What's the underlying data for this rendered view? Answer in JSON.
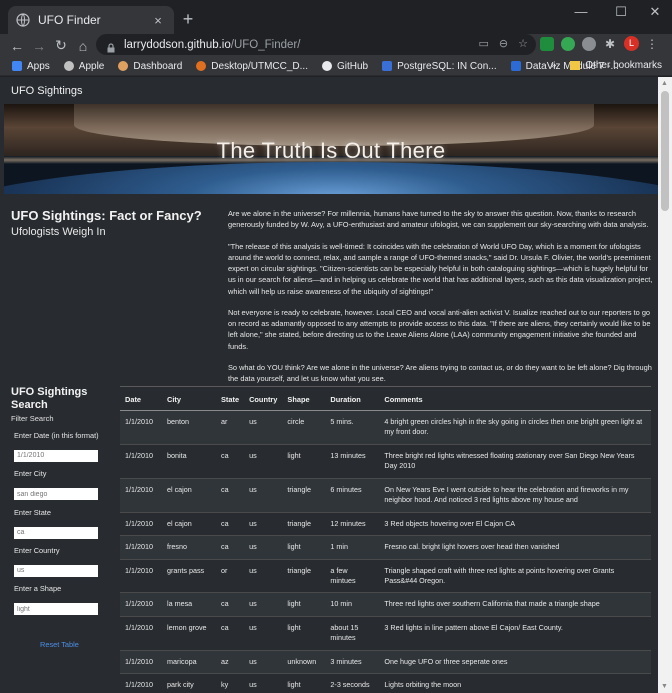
{
  "browser": {
    "tab_title": "UFO Finder",
    "tab_close": "×",
    "new_tab": "+",
    "url_host": "larrydodson.github.io",
    "url_path": "/UFO_Finder/",
    "profile_initial": "L",
    "bookmarks": [
      "Apps",
      "Apple",
      "Dashboard",
      "Desktop/UTMCC_D...",
      "GitHub",
      "PostgreSQL: IN Con...",
      "DataViz Module 7 -..."
    ],
    "bookmarks_more": "»",
    "other_bookmarks": "Other bookmarks"
  },
  "nav": {
    "brand": "UFO Sightings"
  },
  "hero": {
    "title": "The Truth Is Out There"
  },
  "intro": {
    "heading": "UFO Sightings: Fact or Fancy?",
    "subheading": "Ufologists Weigh In",
    "paragraphs": [
      "Are we alone in the universe? For millennia, humans have turned to the sky to answer this question. Now, thanks to research generously funded by W. Avy, a UFO-enthusiast and amateur ufologist, we can supplement our sky-searching with data analysis.",
      "\"The release of this analysis is well-timed: It coincides with the celebration of World UFO Day, which is a moment for ufologists around the world to connect, relax, and sample a range of UFO-themed snacks,\" said Dr. Ursula F. Olivier, the world's preeminent expert on circular sightings. \"Citizen-scientists can be especially helpful in both cataloguing sightings—which is hugely helpful for us in our search for aliens—and in helping us celebrate the world that has additional layers, such as this data visualization project, which will help us raise awareness of the ubiquity of sightings!\"",
      "Not everyone is ready to celebrate, however. Local CEO and vocal anti-alien activist V. Isualize reached out to our reporters to go on record as adamantly opposed to any attempts to provide access to this data. \"If there are aliens, they certainly would like to be left alone,\" she stated, before directing us to the Leave Aliens Alone (LAA) community engagement initiative she founded and funds.",
      "So what do YOU think? Are we alone in the universe? Are aliens trying to contact us, or do they want to be left alone? Dig through the data yourself, and let us know what you see."
    ]
  },
  "filters": {
    "title": "UFO Sightings Search",
    "subtitle": "Filter Search",
    "date_label": "Enter Date (in this format)",
    "date_value": "1/1/2010",
    "city_label": "Enter City",
    "city_value": "san diego",
    "state_label": "Enter State",
    "state_value": "ca",
    "country_label": "Enter Country",
    "country_value": "us",
    "shape_label": "Enter a Shape",
    "shape_value": "light",
    "reset": "Reset Table"
  },
  "table": {
    "headers": [
      "Date",
      "City",
      "State",
      "Country",
      "Shape",
      "Duration",
      "Comments"
    ],
    "rows": [
      [
        "1/1/2010",
        "benton",
        "ar",
        "us",
        "circle",
        "5 mins.",
        "4 bright green circles high in the sky going in circles then one bright green light at my front door."
      ],
      [
        "1/1/2010",
        "bonita",
        "ca",
        "us",
        "light",
        "13 minutes",
        "Three bright red lights witnessed floating stationary over San Diego New Years Day 2010"
      ],
      [
        "1/1/2010",
        "el cajon",
        "ca",
        "us",
        "triangle",
        "6 minutes",
        "On New Years Eve I went outside to hear the celebration and fireworks in my neighbor hood. And noticed 3 red lights above my house and"
      ],
      [
        "1/1/2010",
        "el cajon",
        "ca",
        "us",
        "triangle",
        "12 minutes",
        "3 Red objects hovering over El Cajon CA"
      ],
      [
        "1/1/2010",
        "fresno",
        "ca",
        "us",
        "light",
        "1 min",
        "Fresno cal. bright light hovers over head then vanished"
      ],
      [
        "1/1/2010",
        "grants pass",
        "or",
        "us",
        "triangle",
        "a few mintues",
        "Triangle shaped craft with three red lights at points hovering over Grants Pass&#44 Oregon."
      ],
      [
        "1/1/2010",
        "la mesa",
        "ca",
        "us",
        "light",
        "10 min",
        "Three red lights over southern California that made a triangle shape"
      ],
      [
        "1/1/2010",
        "lemon grove",
        "ca",
        "us",
        "light",
        "about 15 minutes",
        "3 Red lights in line pattern above El Cajon/ East County."
      ],
      [
        "1/1/2010",
        "maricopa",
        "az",
        "us",
        "unknown",
        "3 minutes",
        "One huge UFO or three seperate ones"
      ],
      [
        "1/1/2010",
        "park city",
        "ky",
        "us",
        "light",
        "2-3 seconds",
        "Lights orbiting the moon"
      ]
    ]
  }
}
